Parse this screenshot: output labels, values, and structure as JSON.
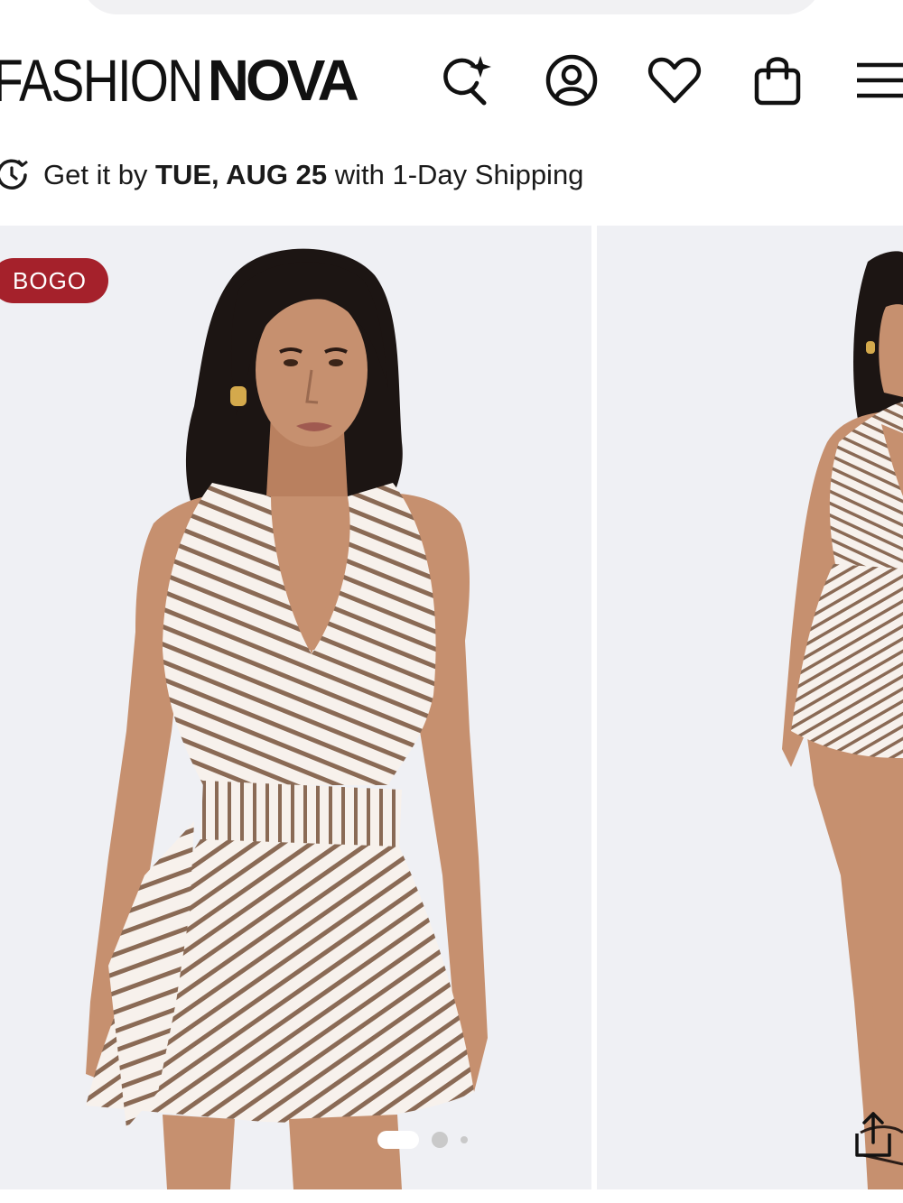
{
  "header": {
    "logo_thin": "FASHION",
    "logo_bold": "NOVA",
    "icons": [
      "ai-search-icon",
      "account-icon",
      "wishlist-heart-icon",
      "shopping-bag-icon",
      "menu-icon"
    ]
  },
  "shipping": {
    "prefix": "Get it by ",
    "date": "TUE, AUG 25",
    "suffix": " with 1-Day Shipping"
  },
  "gallery": {
    "badge": "BOGO",
    "slide_count": 3,
    "active_slide": 1
  },
  "colors": {
    "badge": "#a5212b",
    "background": "#eff0f4",
    "dress_stripe": "#8a6a55",
    "dress_base": "#f7f1ec",
    "skin": "#c6906f",
    "hair": "#1c1513"
  }
}
